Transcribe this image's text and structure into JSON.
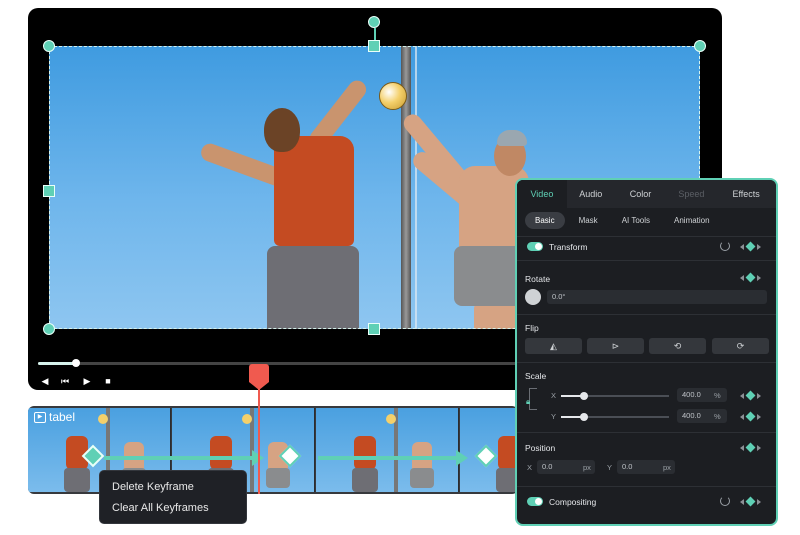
{
  "player": {
    "progress_percent": 8,
    "controls": [
      "prev-frame",
      "step",
      "play",
      "stop"
    ]
  },
  "timeline": {
    "clip_label": "tabel",
    "playhead_color": "#f05a4f"
  },
  "context_menu": {
    "items": [
      "Delete Keyframe",
      "Clear All Keyframes"
    ]
  },
  "panel": {
    "tabs": [
      "Video",
      "Audio",
      "Color",
      "Speed",
      "Effects"
    ],
    "active_tab": "Video",
    "disabled_tab": "Speed",
    "subtabs": [
      "Basic",
      "Mask",
      "AI Tools",
      "Animation"
    ],
    "active_subtab": "Basic",
    "transform_label": "Transform",
    "rotate": {
      "label": "Rotate",
      "value": "0.0°"
    },
    "flip": {
      "label": "Flip"
    },
    "scale": {
      "label": "Scale",
      "x_label": "X",
      "y_label": "Y",
      "x_value": "400.0",
      "y_value": "400.0",
      "unit": "%"
    },
    "position": {
      "label": "Position",
      "x_label": "X",
      "x_value": "0.0",
      "y_label": "Y",
      "y_value": "0.0",
      "unit": "px"
    },
    "compositing_label": "Compositing"
  },
  "colors": {
    "accent": "#5fd0b5",
    "panel_bg": "#1c1e22"
  }
}
